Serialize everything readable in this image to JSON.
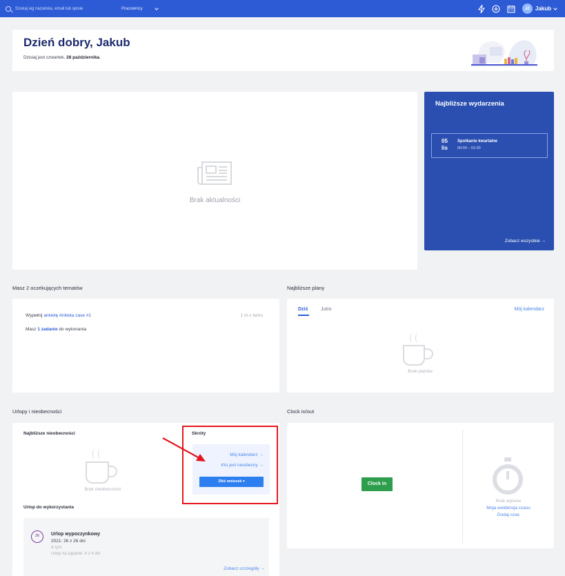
{
  "topbar": {
    "search_placeholder": "Szukaj wg nazwiska, email lub opisie",
    "filter_label": "Pracownicy",
    "user_initials": "JZ",
    "user_name": "Jakub"
  },
  "greeting": {
    "title": "Dzień dobry, Jakub",
    "subtitle_prefix": "Dzisiaj jest czwartek, ",
    "subtitle_date": "28 października",
    "subtitle_suffix": "."
  },
  "news": {
    "empty_text": "Brak aktualności"
  },
  "events": {
    "title": "Najbliższe wydarzenia",
    "items": [
      {
        "day": "05",
        "month": "lis",
        "title": "Spotkanie kwartalne",
        "time": "00:00 – 01:00"
      }
    ],
    "see_all": "Zobacz wszystkie →"
  },
  "pending": {
    "section_title": "Masz 2 oczekujących tematów",
    "row1_prefix": "Wypełnij ",
    "row1_link": "ankietę Ankieta case #1",
    "row1_time": "1 m-c temu",
    "row2_prefix": "Masz ",
    "row2_link": "1 zadanie",
    "row2_suffix": " do wykonania"
  },
  "plans": {
    "section_title": "Najbliższe plany",
    "tab_today": "Dziś",
    "tab_tomorrow": "Jutro",
    "calendar_link": "Mój kalendarz",
    "empty_text": "Brak planów"
  },
  "leave": {
    "section_title": "Urlopy i nieobecności",
    "upcoming_title": "Najbliższe nieobecności",
    "upcoming_empty": "Brak nieobecności",
    "shortcuts_title": "Skróty",
    "shortcut_calendar": "Mój kalendarz →",
    "shortcut_absent": "Kto jest nieobecny →",
    "request_button": "Złóż wniosek ▾",
    "available_title": "Urlop do wykorzystania",
    "item": {
      "badge": "26",
      "title": "Urlop wypoczynkowy",
      "summary": "2021: 26 z 26 dni",
      "including": "w tym",
      "on_demand": "Urlop na żądanie: 4 z 4 dni",
      "details_link": "Zobacz szczegóły →"
    }
  },
  "clock": {
    "section_title": "Clock in/out",
    "button": "Clock in",
    "no_entries": "Brak wpisów",
    "time_tracking_link": "Moja ewidencja czasu",
    "add_time_link": "Dodaj czas"
  },
  "colors": {
    "brand_blue": "#2d5bd6",
    "events_bg": "#2a4fb0",
    "clock_green": "#2e9e4c",
    "annotation_red": "#e5141c"
  }
}
